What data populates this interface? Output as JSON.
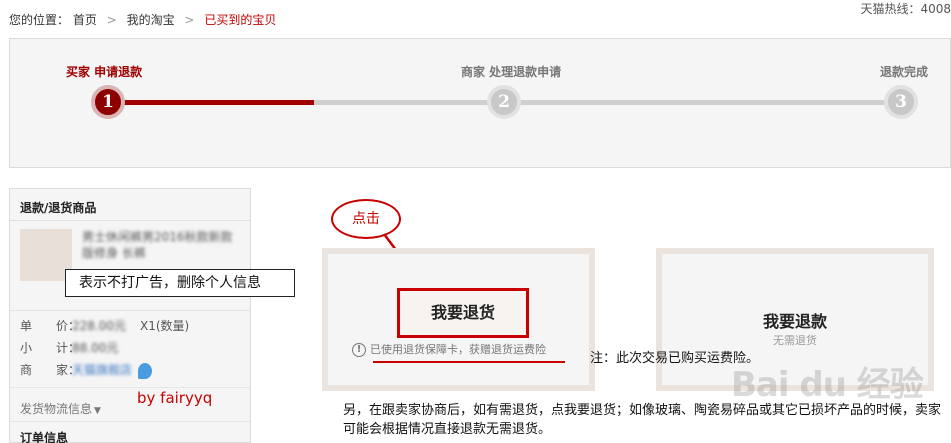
{
  "breadcrumb": {
    "prefix": "您的位置：",
    "items": [
      "首页",
      "我的淘宝",
      "已买到的宝贝"
    ],
    "separator": ">"
  },
  "hotline": "天猫热线：4008",
  "progress": {
    "steps": [
      {
        "number": "1",
        "label": "买家 申请退款"
      },
      {
        "number": "2",
        "label": "商家 处理退款申请"
      },
      {
        "number": "3",
        "label": "退款完成"
      }
    ]
  },
  "left_panel": {
    "title": "退款/退货商品",
    "item_title_blurred": "男士休闲裤男2016秋款新款 版修身 长裤",
    "annotation": "表示不打广告，删除个人信息",
    "price_label": "单　　价：",
    "price_value": "228.00元",
    "quantity": "X1(数量)",
    "subtotal_label": "小　　计：",
    "subtotal_value": "88.00元",
    "merchant_label": "商　　家：",
    "merchant_value": "天猫旗舰店",
    "logistics": "发货物流信息",
    "order_info": "订单信息",
    "author": "by fairyyq"
  },
  "annotation_click": "点击",
  "options": {
    "return_goods": {
      "button": "我要退货",
      "notice": "已使用退货保障卡，获赠退货运费险"
    },
    "refund_only": {
      "title": "我要退款",
      "subtitle": "无需退货"
    }
  },
  "note": "注：此次交易已购买运费险。",
  "paragraph": "另，在跟卖家协商后，如有需退货，点我要退货；如像玻璃、陶瓷易碎品或其它已损坏产品的时候，卖家可能会根据情况直接退款无需退货。",
  "watermark": "Bai du 经验",
  "colors": {
    "accent": "#a00000",
    "annotation_red": "#c80000",
    "inactive_step": "#c8c8c8"
  }
}
